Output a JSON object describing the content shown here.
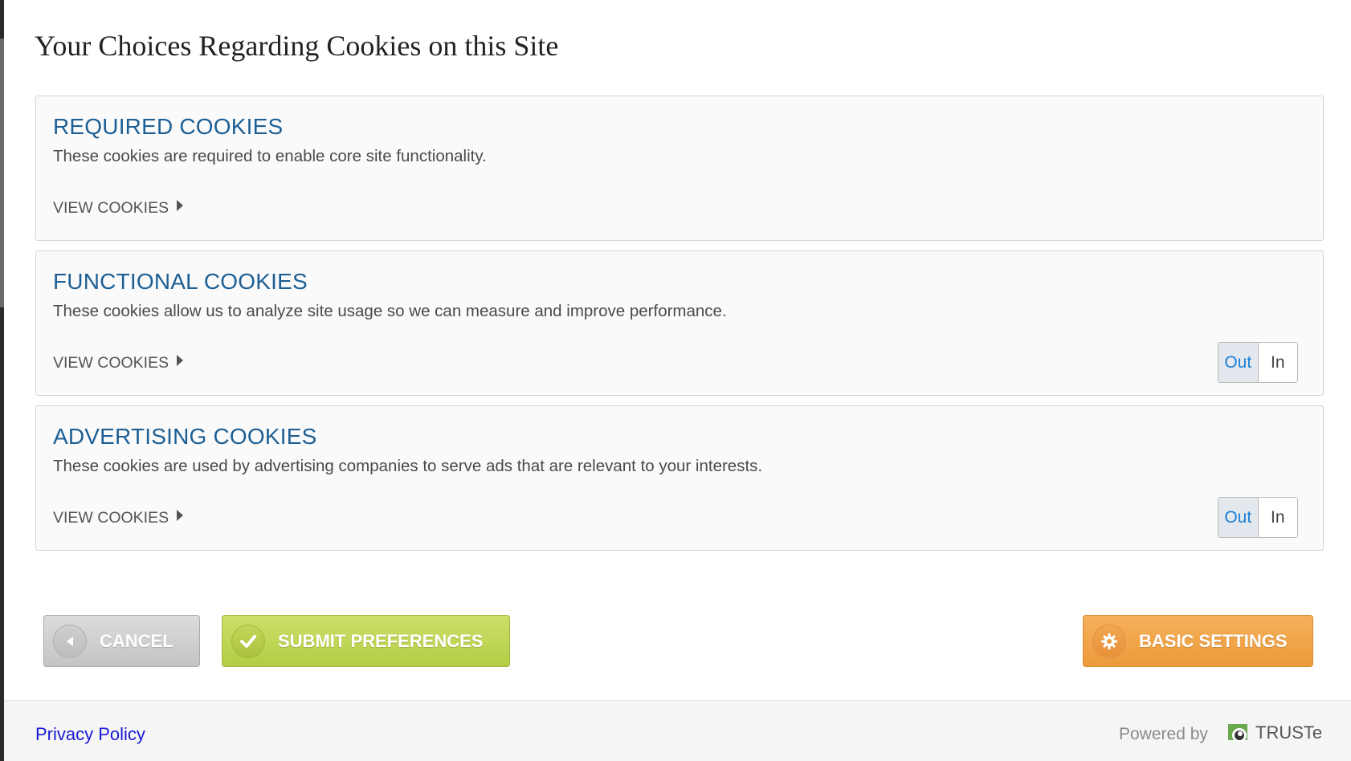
{
  "page": {
    "title": "Your Choices Regarding Cookies on this Site"
  },
  "categories": [
    {
      "title": "REQUIRED COOKIES",
      "description": "These cookies are required to enable core site functionality.",
      "view_label": "VIEW COOKIES",
      "has_toggle": false
    },
    {
      "title": "FUNCTIONAL COOKIES",
      "description": "These cookies allow us to analyze site usage so we can measure and improve performance.",
      "view_label": "VIEW COOKIES",
      "has_toggle": true,
      "toggle": {
        "out_label": "Out",
        "in_label": "In",
        "selected": "Out"
      }
    },
    {
      "title": "ADVERTISING COOKIES",
      "description": "These cookies are used by advertising companies to serve ads that are relevant to your interests.",
      "view_label": "VIEW COOKIES",
      "has_toggle": true,
      "toggle": {
        "out_label": "Out",
        "in_label": "In",
        "selected": "Out"
      }
    }
  ],
  "actions": {
    "cancel_label": "CANCEL",
    "cancel_icon": "chevron-left-icon",
    "submit_label": "SUBMIT PREFERENCES",
    "submit_icon": "checkmark-icon",
    "basic_settings_label": "BASIC SETTINGS",
    "basic_settings_icon": "gear-icon"
  },
  "footer": {
    "privacy_link": "Privacy Policy",
    "powered_by": "Powered by",
    "brand": "TRUSTe"
  },
  "colors": {
    "heading_blue": "#1d5f94",
    "toggle_selected_text": "#1a7fd6",
    "cancel_gray": "#c4c4c4",
    "submit_green": "#b3cd45",
    "basic_orange": "#ec9a3a",
    "link_blue": "#1a1ad6"
  }
}
